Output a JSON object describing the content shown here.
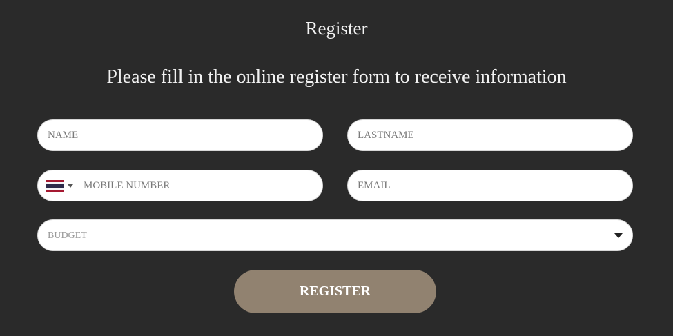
{
  "form": {
    "title": "Register",
    "subtitle": "Please fill in the online register form to receive information",
    "name": {
      "placeholder": "NAME",
      "value": ""
    },
    "lastname": {
      "placeholder": "LASTNAME",
      "value": ""
    },
    "mobile": {
      "placeholder": "MOBILE NUMBER",
      "value": "",
      "country_icon": "thailand-flag-icon",
      "dropdown_icon": "caret-down-icon"
    },
    "email": {
      "placeholder": "EMAIL",
      "value": ""
    },
    "budget": {
      "selected": "BUDGET",
      "dropdown_icon": "caret-down-icon"
    },
    "submit_label": "REGISTER"
  },
  "colors": {
    "background": "#2a2a2a",
    "title_text": "#f2f2f2",
    "field_background": "#ffffff",
    "placeholder_text": "#7a7a7a",
    "button_background": "#918270",
    "button_text": "#ffffff",
    "flag_red": "#a51931",
    "flag_white": "#f4f5f8",
    "flag_blue": "#2d2a4a"
  }
}
